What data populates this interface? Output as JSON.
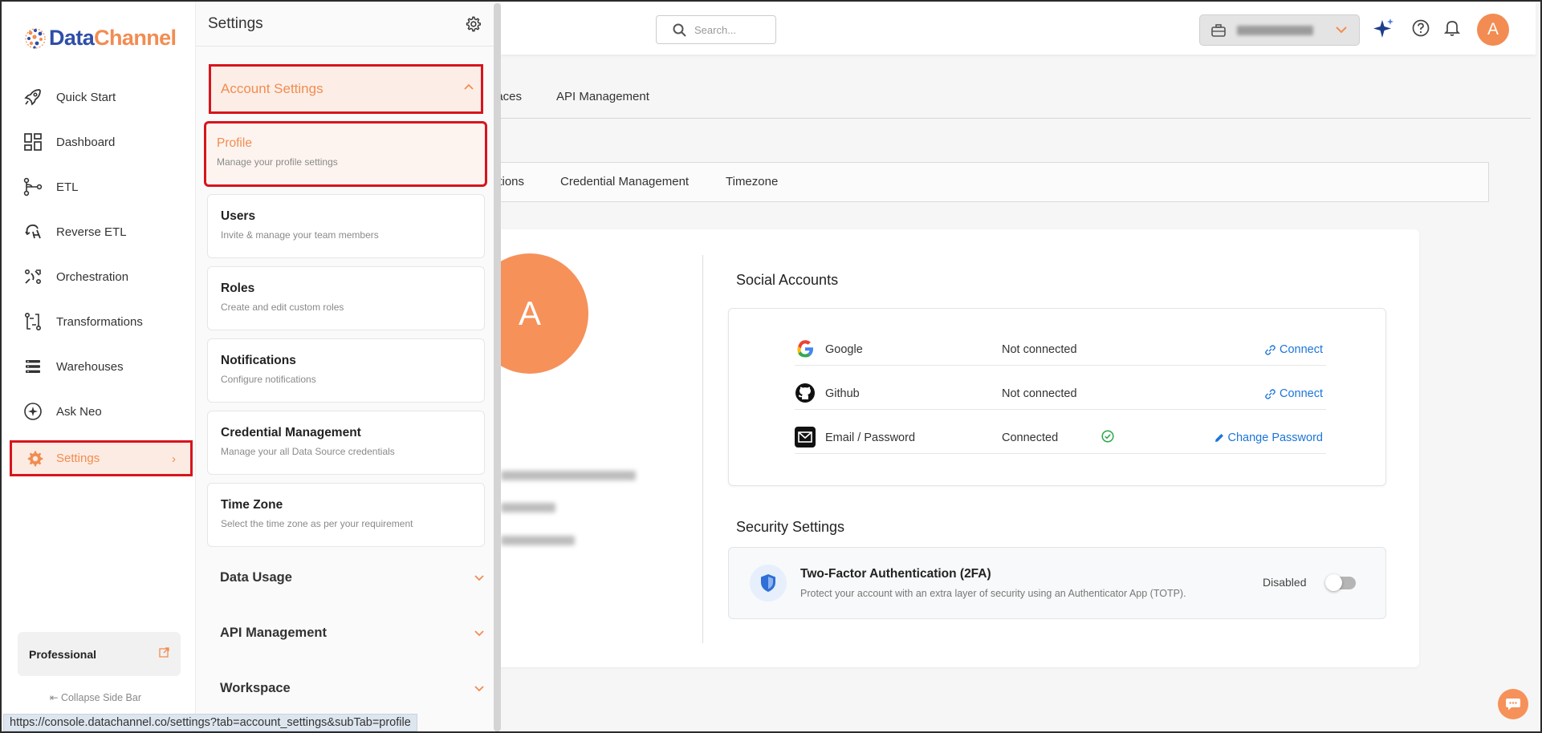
{
  "brand": {
    "logo_data": "Data",
    "logo_channel": "Channel"
  },
  "nav": [
    {
      "label": "Quick Start",
      "icon": "rocket-icon"
    },
    {
      "label": "Dashboard",
      "icon": "dashboard-icon"
    },
    {
      "label": "ETL",
      "icon": "etl-icon"
    },
    {
      "label": "Reverse ETL",
      "icon": "reverse-etl-icon"
    },
    {
      "label": "Orchestration",
      "icon": "orchestration-icon"
    },
    {
      "label": "Transformations",
      "icon": "transformations-icon"
    },
    {
      "label": "Warehouses",
      "icon": "warehouses-icon"
    },
    {
      "label": "Ask Neo",
      "icon": "ask-neo-icon"
    }
  ],
  "settings_nav": {
    "label": "Settings",
    "chevron": "›"
  },
  "plan": {
    "label": "Professional"
  },
  "collapse": {
    "label": "Collapse Side Bar"
  },
  "panel": {
    "title": "Settings",
    "account_settings": "Account Settings",
    "cards": [
      {
        "title": "Profile",
        "desc": "Manage your profile settings"
      },
      {
        "title": "Users",
        "desc": "Invite & manage your team members"
      },
      {
        "title": "Roles",
        "desc": "Create and edit custom roles"
      },
      {
        "title": "Notifications",
        "desc": "Configure notifications"
      },
      {
        "title": "Credential Management",
        "desc": "Manage your all Data Source credentials"
      },
      {
        "title": "Time Zone",
        "desc": "Select the time zone as per your requirement"
      }
    ],
    "sections": [
      "Data Usage",
      "API Management",
      "Workspace"
    ]
  },
  "topbar": {
    "search_placeholder": "Search...",
    "user_initial": "A"
  },
  "tabs_top": [
    "paces",
    "API Management"
  ],
  "tabs_sub": [
    "ations",
    "Credential Management",
    "Timezone"
  ],
  "profile": {
    "initial": "A"
  },
  "social": {
    "heading": "Social Accounts",
    "rows": [
      {
        "name": "Google",
        "status": "Not connected",
        "action": "Connect"
      },
      {
        "name": "Github",
        "status": "Not connected",
        "action": "Connect"
      },
      {
        "name": "Email / Password",
        "status": "Connected",
        "action": "Change Password"
      }
    ]
  },
  "security": {
    "heading": "Security Settings",
    "title": "Two-Factor Authentication (2FA)",
    "desc": "Protect your account with an extra layer of security using an Authenticator App (TOTP).",
    "status": "Disabled",
    "enabled": false
  },
  "status_url": "https://console.datachannel.co/settings?tab=account_settings&subTab=profile",
  "colors": {
    "accent": "#f28c52",
    "highlight": "#d8141c",
    "link": "#1c75d8",
    "brand_blue": "#2e4ea8"
  }
}
